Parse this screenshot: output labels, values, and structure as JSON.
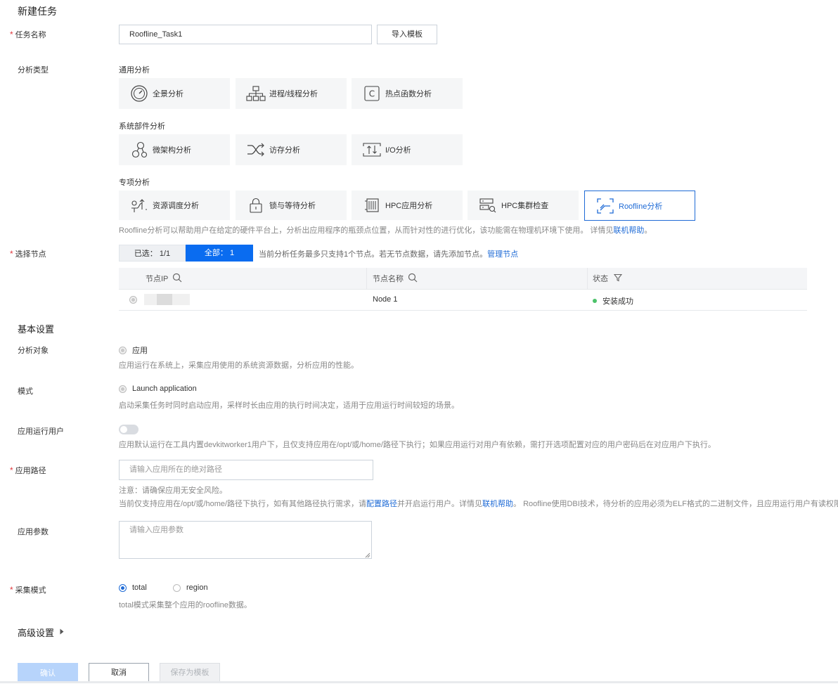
{
  "page": {
    "title": "新建任务"
  },
  "task_name": {
    "label": "任务名称",
    "value": "Roofline_Task1",
    "import_button": "导入模板"
  },
  "analysis_type": {
    "label": "分析类型",
    "general": {
      "title": "通用分析",
      "items": [
        "全景分析",
        "进程/线程分析",
        "热点函数分析"
      ]
    },
    "system": {
      "title": "系统部件分析",
      "items": [
        "微架构分析",
        "访存分析",
        "I/O分析"
      ]
    },
    "special": {
      "title": "专项分析",
      "items": [
        "资源调度分析",
        "锁与等待分析",
        "HPC应用分析",
        "HPC集群检查",
        "Roofline分析"
      ]
    },
    "description": "Roofline分析可以帮助用户在给定的硬件平台上，分析出应用程序的瓶颈点位置，从而针对性的进行优化，该功能需在物理机环境下使用。 详情见",
    "description_link": "联机帮助",
    "description_end": "。",
    "selected": "Roofline分析"
  },
  "node_select": {
    "label": "选择节点",
    "tab_selected": "已选：  1/1",
    "tab_all": "全部：  1",
    "hint": "当前分析任务最多只支持1个节点。若无节点数据，请先添加节点。",
    "hint_link": "管理节点",
    "columns": [
      "节点IP",
      "节点名称",
      "状态"
    ],
    "rows": [
      {
        "ip": "",
        "name": "Node 1",
        "status": "安装成功"
      }
    ],
    "status_color": "#4cc26a"
  },
  "basic_settings": {
    "title": "基本设置",
    "target": {
      "label": "分析对象",
      "value": "应用",
      "hint": "应用运行在系统上，采集应用使用的系统资源数据，分析应用的性能。"
    },
    "mode": {
      "label": "模式",
      "value": "Launch application",
      "hint": "启动采集任务时同时启动应用，采样时长由应用的执行时间决定，适用于应用运行时间较短的场景。"
    },
    "run_user": {
      "label": "应用运行用户",
      "hint": "应用默认运行在工具内置devkitworker1用户下，且仅支持应用在/opt/或/home/路径下执行；如果应用运行对用户有依赖，需打开选项配置对应的用户密码后在对应用户下执行。"
    },
    "app_path": {
      "label": "应用路径",
      "placeholder": "请输入应用所在的绝对路径",
      "note1": "注意：请确保应用无安全风险。",
      "note2_a": "当前仅支持应用在/opt/或/home/路径下执行，如有其他路径执行需求，请",
      "note2_link1": "配置路径",
      "note2_b": "并开启运行用户。详情见",
      "note2_link2": "联机帮助",
      "note2_c": "。 Roofline使用DBI技术，待分析的应用必须为ELF格式的二进制文件，且应用运行用户有读权限。"
    },
    "app_params": {
      "label": "应用参数",
      "placeholder": "请输入应用参数"
    },
    "collect_mode": {
      "label": "采集模式",
      "options": [
        "total",
        "region"
      ],
      "selected": "total",
      "hint": "total模式采集整个应用的roofline数据。"
    }
  },
  "advanced": {
    "title": "高级设置"
  },
  "footer": {
    "confirm": "确认",
    "cancel": "取消",
    "save_template": "保存为模板"
  },
  "colors": {
    "primary": "#1f6bd6",
    "tab_active": "#0a6cf0",
    "required": "#e0393e"
  }
}
